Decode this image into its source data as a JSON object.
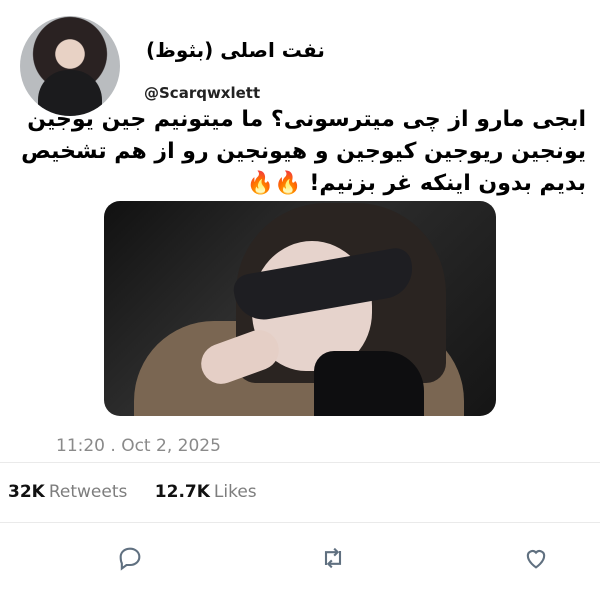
{
  "profile": {
    "display_name": "نفت اصلی (بثوظ)",
    "handle": "@Scarqwxlett"
  },
  "tweet": {
    "text": "ابجی مارو از چی میترسونی؟ ما میتونیم جین یوجین یونجین ریوجین کیوجین و هیونجین رو از هم تشخیص بدیم بدون اینکه غر بزنیم! 🔥🔥",
    "timestamp": "11:20 . Oct 2, 2025"
  },
  "stats": {
    "retweets_count": "32K",
    "retweets_label": "Retweets",
    "likes_count": "12.7K",
    "likes_label": "Likes"
  },
  "icons": {
    "reply": "reply-icon",
    "retweet": "retweet-icon",
    "like": "like-icon"
  },
  "colors": {
    "text": "#000000",
    "muted": "#8a8a8a",
    "icon": "#607080"
  }
}
